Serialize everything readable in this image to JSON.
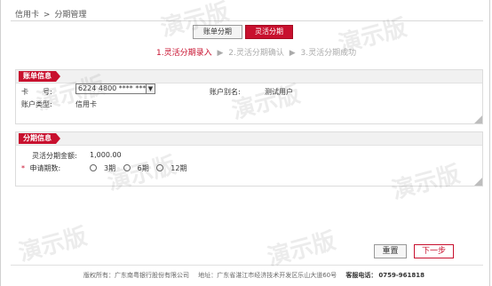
{
  "breadcrumb": {
    "root": "信用卡",
    "separator": ">",
    "current": "分期管理"
  },
  "tabs": [
    {
      "label": "账单分期",
      "active": false
    },
    {
      "label": "灵活分期",
      "active": true
    }
  ],
  "steps": [
    {
      "label": "1.灵活分期录入",
      "active": true
    },
    {
      "label": "2.灵活分期确认",
      "active": false
    },
    {
      "label": "3.灵活分期成功",
      "active": false
    }
  ],
  "step_separator": "▶",
  "account_panel": {
    "title": "账单信息",
    "card_label": "卡　　号:",
    "card_value": "6224 4800 **** ***8",
    "alias_label": "账户别名:",
    "alias_value": "测试用户",
    "type_label": "账户类型:",
    "type_value": "信用卡"
  },
  "installment_panel": {
    "title": "分期信息",
    "amount_label": "灵活分期金额:",
    "amount_value": "1,000.00",
    "required_mark": "*",
    "periods_label": "申请期数:",
    "periods": [
      "3期",
      "6期",
      "12期"
    ]
  },
  "buttons": {
    "reset": "重置",
    "next": "下一步"
  },
  "footer": {
    "copyright": "版权所有：广东南粤银行股份有限公司",
    "address": "地址：广东省湛江市经济技术开发区乐山大道60号",
    "phone_label": "客服电话：",
    "phone": "0759-961818"
  },
  "watermark_text": "演示版",
  "colors": {
    "accent": "#c8102e",
    "panel_header": "#f1f1f1"
  }
}
